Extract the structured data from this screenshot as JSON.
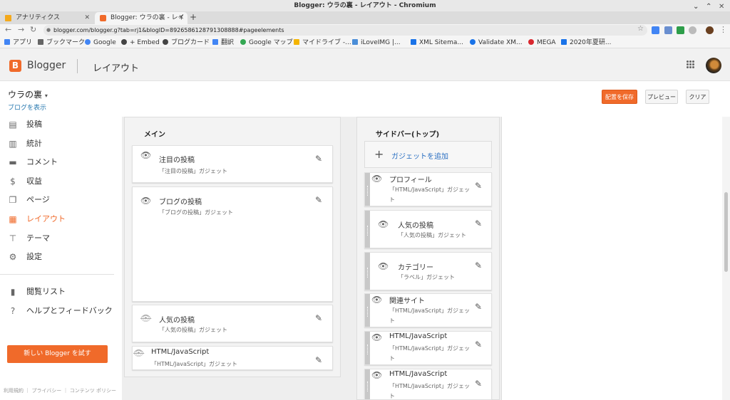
{
  "window": {
    "title": "Blogger: ウラの裏 - レイアウト - Chromium"
  },
  "tabs": [
    {
      "label": "アナリティクス",
      "color": "#f4a91c"
    },
    {
      "label": "Blogger: ウラの裏 - レイ",
      "color": "#f06a2a"
    }
  ],
  "address": {
    "url": "blogger.com/blogger.g?tab=rj1&blogID=8926586128791308888#pageelements"
  },
  "bookmarks": [
    {
      "label": "アプリ",
      "color": "#4285f4"
    },
    {
      "label": "ブックマーク",
      "color": "#666666"
    },
    {
      "label": "Google",
      "color": "#4285f4"
    },
    {
      "label": "+ Embed",
      "color": "#444444"
    },
    {
      "label": "ブログカード",
      "color": "#444444"
    },
    {
      "label": "翻訳",
      "color": "#4285f4"
    },
    {
      "label": "Google マップ",
      "color": "#34a853"
    },
    {
      "label": "マイドライブ -...",
      "color": "#f4b400"
    },
    {
      "label": "iLoveIMG |...",
      "color": "#4b8ed8"
    },
    {
      "label": "XML Sitema...",
      "color": "#1a73e8"
    },
    {
      "label": "Validate XM...",
      "color": "#1a73e8"
    },
    {
      "label": "MEGA",
      "color": "#d9272e"
    },
    {
      "label": "2020年夏研...",
      "color": "#1a73e8"
    }
  ],
  "blogger_header": {
    "brand": "Blogger",
    "section": "レイアウト"
  },
  "blog": {
    "title": "ウラの裏",
    "view_link": "ブログを表示"
  },
  "actions": {
    "save": "配置を保存",
    "preview": "プレビュー",
    "clear": "クリア"
  },
  "nav": [
    {
      "label": "投稿",
      "icon": "posts-icon"
    },
    {
      "label": "統計",
      "icon": "stats-icon"
    },
    {
      "label": "コメント",
      "icon": "comments-icon"
    },
    {
      "label": "収益",
      "icon": "earnings-icon"
    },
    {
      "label": "ページ",
      "icon": "pages-icon"
    },
    {
      "label": "レイアウト",
      "icon": "layout-icon",
      "active": true
    },
    {
      "label": "テーマ",
      "icon": "theme-icon"
    },
    {
      "label": "設定",
      "icon": "settings-icon"
    },
    {
      "label": "閲覧リスト",
      "icon": "reading-list-icon"
    },
    {
      "label": "ヘルプとフィードバック",
      "icon": "help-icon"
    }
  ],
  "new_blogger_button": "新しい Blogger を試す",
  "footer": "利用規約 ｜ プライバシー ｜ コンテンツ ポリシー",
  "main_section": {
    "title": "メイン",
    "gadgets": [
      {
        "name": "注目の投稿",
        "type": "「注目の投稿」ガジェット",
        "visible": true
      },
      {
        "name": "ブログの投稿",
        "type": "「ブログの投稿」ガジェット",
        "visible": true
      },
      {
        "name": "人気の投稿",
        "type": "「人気の投稿」ガジェット",
        "visible": false
      },
      {
        "name": "HTML/JavaScript",
        "type": "「HTML/JavaScript」ガジェット",
        "visible": false
      }
    ]
  },
  "sidebar_section": {
    "title": "サイドバー(トップ)",
    "add_gadget": "ガジェットを追加",
    "gadgets": [
      {
        "name": "プロフィール",
        "type1": "「HTML/JavaScript」ガジェッ",
        "type2": "ト",
        "visible": true
      },
      {
        "name": "人気の投稿",
        "type1": "「人気の投稿」ガジェット",
        "type2": "",
        "visible": true
      },
      {
        "name": "カテゴリー",
        "type1": "「ラベル」ガジェット",
        "type2": "",
        "visible": true
      },
      {
        "name": "関連サイト",
        "type1": "「HTML/JavaScript」ガジェッ",
        "type2": "ト",
        "visible": true
      },
      {
        "name": "HTML/JavaScript",
        "type1": "「HTML/JavaScript」ガジェッ",
        "type2": "ト",
        "visible": true
      },
      {
        "name": "HTML/JavaScript",
        "type1": "「HTML/JavaScript」ガジェッ",
        "type2": "ト",
        "visible": true
      }
    ]
  }
}
